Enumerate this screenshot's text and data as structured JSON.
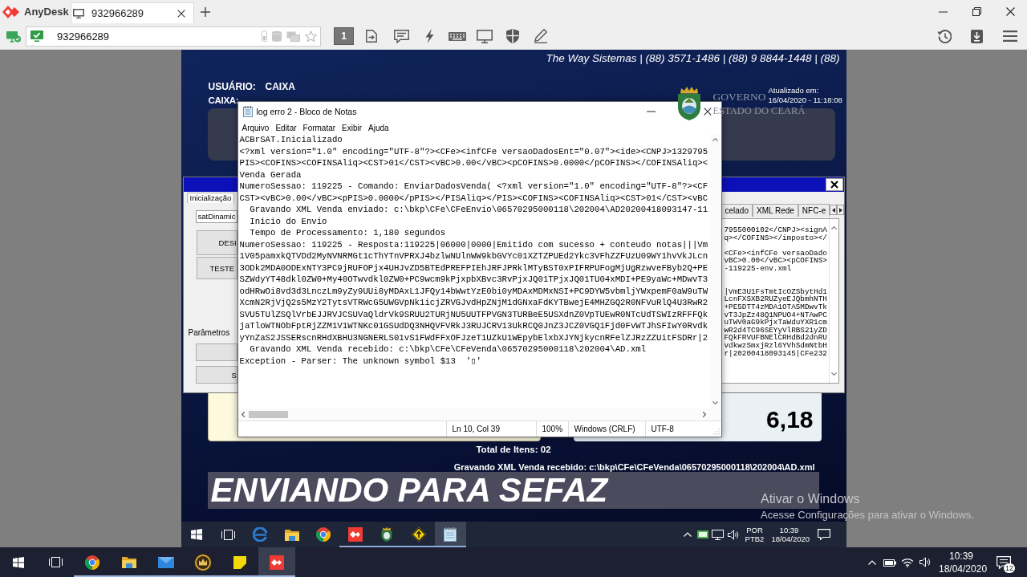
{
  "anydesk": {
    "app_name": "AnyDesk",
    "tabs": [
      {
        "label": "932966289",
        "selected": true
      }
    ],
    "address": {
      "value": "932966289"
    },
    "display_button": "1"
  },
  "remote_app": {
    "contact_line": "The Way Sistemas | (88) 3571-1486 | (88) 9 8844-1448 | (88)",
    "user_label": "USUÁRIO:",
    "user_value": "CAIXA",
    "register": "CAIXA:",
    "logo_text": [
      "GOVERNO",
      "ESTADO DO CEARÁ"
    ],
    "updated": [
      "Atualizado em:",
      "16/04/2020 - 11:18:08"
    ],
    "total_value": "6,18",
    "total_items": "Total de Itens: 02",
    "status_line": "Gravando XML Venda recebido: c:\\bkp\\CFe\\CFeVenda\\06570295000118\\202004\\AD.xml",
    "banner": "ENVIANDO PARA SEFAZ"
  },
  "config_dialog": {
    "tabs": [
      {
        "label": "Inicialização",
        "selected": true
      }
    ],
    "combo_value": "satDinamic",
    "buttons": [
      "DESI",
      "TESTE"
    ],
    "section_label": "Parâmetros",
    "section_button": "S",
    "right_tabs": [
      {
        "label": "celado",
        "selected": false
      },
      {
        "label": "XML Rede",
        "selected": false
      },
      {
        "label": "NFC-e",
        "selected": false
      }
    ],
    "memo_text": "7955000102</CNPJ><signA\nq></COFINS></imposto></\n\n<CFe><infCFe versaoDado\nvBC>0.00</vBC><pCOFINS>\n-119225-env.xml\n\n\n|VmE3U1FsTmtIcOZSbytHd1\nLcnFXSXB2RUZyeEJQbmhNTH\n+PE5DTT4zMDA1OTA5MDwvTk\nvT3JpZz48Q1NPUO4+NTAwPC\nuTWV0aG9kPjxTaWduYXR1cm\nwR2d4TC96SEYyVlRBS21yZD\nFQkFRVUFBNElCRHdBd2dnRU\nvdkwzSmxjRzl6YVhSdmNtbH\nr|20200418093145|CFe232"
  },
  "notepad": {
    "title": "log erro 2 - Bloco de Notas",
    "menu": [
      "Arquivo",
      "Editar",
      "Formatar",
      "Exibir",
      "Ajuda"
    ],
    "lines": [
      "ACBrSAT.Inicializado",
      "<?xml version=\"1.0\" encoding=\"UTF-8\"?><CFe><infCFe versaoDadosEnt=\"0.07\"><ide><CNPJ>1329795",
      "PIS><COFINS><COFINSAliq><CST>01</CST><vBC>0.00</vBC><pCOFINS>0.0000</pCOFINS></COFINSAliq><",
      "Venda Gerada",
      "NumeroSessao: 119225 - Comando: EnviarDadosVenda( <?xml version=\"1.0\" encoding=\"UTF-8\"?><CF",
      "CST><vBC>0.00</vBC><pPIS>0.0000</pPIS></PISAliq></PIS><COFINS><COFINSAliq><CST>01</CST><vBC",
      "  Gravando XML Venda enviado: c:\\bkp\\CFe\\CFeEnvio\\06570295000118\\202004\\AD20200418093147-11",
      "  Inicio do Envio",
      "  Tempo de Processamento: 1,180 segundos",
      "NumeroSessao: 119225 - Resposta:119225|06000|0000|Emitido com sucesso + conteudo notas|||Vm",
      "1V05pamxkQTVDd2MyNVNRMGt1cThYTnVPRXJ4bzlwNUlnWW9kbGVYc01XZTZPUEd2Ykc3VFhZZFUzU09WY1hvVkJLcn",
      "3ODk2MDA0ODExNTY3PC9jRUFOPjx4UHJvZD5BTEdPREFPIEhJRFJPRklMTyBST0xPIFRPUFogMjUgRzwveFByb2Q+PE",
      "SZWdyYT48dkl0ZW0+My40OTwvdkl0ZW0+PC9wcm9kPjxpbXBvc3RvPjxJQ01TPjxJQ01TU04xMDI+PE9yaWc+MDwvT3",
      "odHRwOi8vd3d3LnczLm9yZy9UUi8yMDAxL1JFQy14bWwtYzE0bi0yMDAxMDMxNSI+PC9DYW5vbmljYWxpemF0aW9uTW",
      "XcmN2RjVjQ2s5MzY2TytsVTRWcG5UWGVpNk1icjZRVGJvdHpZNjM1dGNxaFdKYTBwejE4MHZGQ2R0NFVuRlQ4U3RwR2",
      "SVU5TUlZSQlVrbEJJRVJCSUVaQldrVk9SRUU2TURjNU5UUTFPVGN3TURBeE5USXdnZ0VpTUEwR0NTcUdTSWIzRFFFQk",
      "jaTloWTNObFptRjZZM1V1WTNKc01GSUdDQ3NHQVFVRkJ3RUJCRV13UkRCQ0JnZ3JCZ0VGQ1Fjd0FvWTJhSFIwY0Rvdk",
      "yYnZaS2JSSERscnRHdXBHU3NGNERLS01vS1FWdFFxOFJzeT1UZkU1WEpybElxbXJYNjkycnRFelZJRzZZUitFSDRr|2",
      "  Gravando XML Venda recebido: c:\\bkp\\CFe\\CFeVenda\\06570295000118\\202004\\AD.xml",
      "Exception - Parser: The unknown symbol $13  '▯'"
    ],
    "status": [
      "Ln 10, Col 39",
      "100%",
      "Windows (CRLF)",
      "UTF-8"
    ]
  },
  "remote_taskbar": {
    "apps": [
      {
        "kind": "edge",
        "running": false,
        "selected": false
      },
      {
        "kind": "folder",
        "running": false,
        "selected": false
      },
      {
        "kind": "browser",
        "running": false,
        "selected": false
      },
      {
        "kind": "remote",
        "running": true,
        "selected": false
      },
      {
        "kind": "emblem",
        "running": true,
        "selected": false
      },
      {
        "kind": "sign",
        "running": true,
        "selected": false
      },
      {
        "kind": "notepad",
        "running": true,
        "selected": true
      }
    ],
    "language": [
      "POR",
      "PTB2"
    ],
    "clock": [
      "10:39",
      "18/04/2020"
    ]
  },
  "activation_notice": [
    "Ativar o Windows",
    "Acesse Configurações para ativar o Windows."
  ],
  "taskbar": {
    "apps": [
      {
        "kind": "browser",
        "running": true,
        "selected": false
      },
      {
        "kind": "folder",
        "running": true,
        "selected": false
      },
      {
        "kind": "mail",
        "running": true,
        "selected": false
      },
      {
        "kind": "game",
        "running": true,
        "selected": false
      },
      {
        "kind": "sticky",
        "running": true,
        "selected": false
      },
      {
        "kind": "remote",
        "running": true,
        "selected": true
      }
    ],
    "clock": [
      "10:39",
      "18/04/2020"
    ],
    "notification_count": "12"
  }
}
